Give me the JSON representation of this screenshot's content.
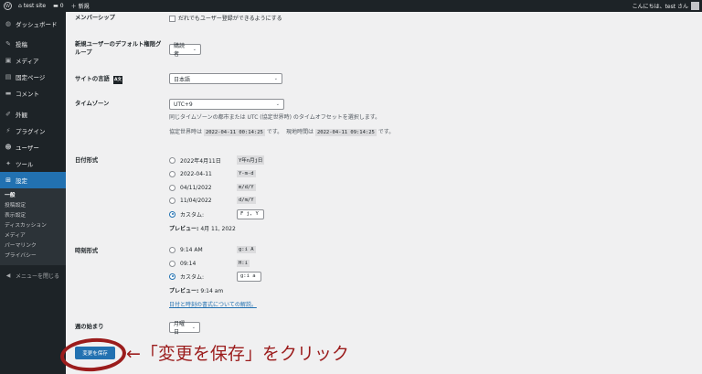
{
  "adminbar": {
    "site_name": "test site",
    "comments_count": "0",
    "new_label": "新規",
    "greeting": "こんにちは、test さん"
  },
  "sidebar": {
    "items": [
      {
        "label": "ダッシュボード",
        "icon": "dashboard-icon",
        "glyph": "◍"
      },
      {
        "label": "投稿",
        "icon": "pin-icon",
        "glyph": "✎"
      },
      {
        "label": "メディア",
        "icon": "media-icon",
        "glyph": "▣"
      },
      {
        "label": "固定ページ",
        "icon": "page-icon",
        "glyph": "▤"
      },
      {
        "label": "コメント",
        "icon": "comment-icon",
        "glyph": "▬"
      },
      {
        "label": "外観",
        "icon": "brush-icon",
        "glyph": "✐"
      },
      {
        "label": "プラグイン",
        "icon": "plugin-icon",
        "glyph": "⚡"
      },
      {
        "label": "ユーザー",
        "icon": "user-icon",
        "glyph": "☻"
      },
      {
        "label": "ツール",
        "icon": "wrench-icon",
        "glyph": "✦"
      },
      {
        "label": "設定",
        "icon": "settings-icon",
        "glyph": "⊞"
      }
    ],
    "submenu": [
      "一般",
      "投稿設定",
      "表示設定",
      "ディスカッション",
      "メディア",
      "パーマリンク",
      "プライバシー"
    ],
    "collapse_label": "メニューを閉じる"
  },
  "membership": {
    "label": "メンバーシップ",
    "checkbox_label": "だれでもユーザー登録ができるようにする"
  },
  "default_role": {
    "label": "新規ユーザーのデフォルト権限グループ",
    "value": "購読者"
  },
  "site_language": {
    "label": "サイトの言語",
    "value": "日本語"
  },
  "timezone": {
    "label": "タイムゾーン",
    "value": "UTC+9",
    "description": "同じタイムゾーンの都市または UTC (協定世界時) のタイムオフセットを選択します。",
    "utc_prefix": "協定世界時は",
    "utc_time": "2022-04-11 00:14:25",
    "utc_suffix": "です。",
    "local_prefix": "現地時間は",
    "local_time": "2022-04-11 09:14:25",
    "local_suffix": "です。"
  },
  "date_format": {
    "label": "日付形式",
    "options": [
      {
        "display": "2022年4月11日",
        "code": "Y年n月j日"
      },
      {
        "display": "2022-04-11",
        "code": "Y-m-d"
      },
      {
        "display": "04/11/2022",
        "code": "m/d/Y"
      },
      {
        "display": "11/04/2022",
        "code": "d/m/Y"
      }
    ],
    "custom_label": "カスタム:",
    "custom_value": "F j, Y",
    "preview_label": "プレビュー:",
    "preview_value": "4月 11, 2022"
  },
  "time_format": {
    "label": "時刻形式",
    "options": [
      {
        "display": "9:14 AM",
        "code": "g:i A"
      },
      {
        "display": "09:14",
        "code": "H:i"
      }
    ],
    "custom_label": "カスタム:",
    "custom_value": "g:i a",
    "preview_label": "プレビュー:",
    "preview_value": "9:14 am",
    "doc_link": "日付と時刻の書式についての解説。"
  },
  "week_start": {
    "label": "週の始まり",
    "value": "月曜日"
  },
  "save_button": "変更を保存",
  "annotation": "←「変更を保存」をクリック",
  "colors": {
    "primary": "#2271b1",
    "admin_dark": "#1d2327",
    "annotation_red": "#9b1c1c"
  }
}
